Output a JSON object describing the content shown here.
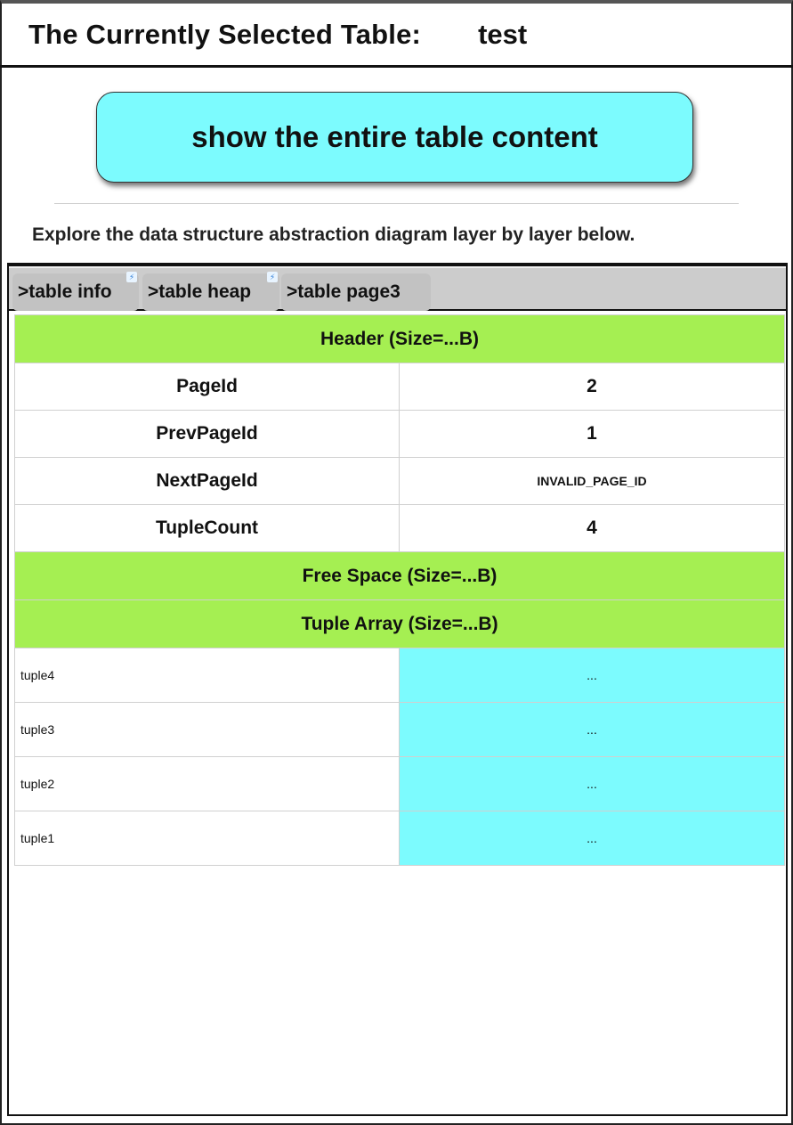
{
  "header": {
    "title_label": "The Currently Selected Table:",
    "table_name": "test"
  },
  "actions": {
    "show_button_label": "show the entire table content"
  },
  "instructions": "Explore the data structure abstraction diagram layer by layer below.",
  "breadcrumb": {
    "tabs": [
      {
        "label": ">table info",
        "badge": true
      },
      {
        "label": ">table heap",
        "badge": true
      },
      {
        "label": ">table page3",
        "badge": false
      }
    ]
  },
  "page": {
    "header_section": "Header (Size=...B)",
    "fields": [
      {
        "name": "PageId",
        "value": "2"
      },
      {
        "name": "PrevPageId",
        "value": "1"
      },
      {
        "name": "NextPageId",
        "value": "INVALID_PAGE_ID"
      },
      {
        "name": "TupleCount",
        "value": "4"
      }
    ],
    "free_space_section": "Free Space (Size=...B)",
    "tuple_array_section": "Tuple Array (Size=...B)",
    "tuples": [
      {
        "name": "tuple4",
        "value": "..."
      },
      {
        "name": "tuple3",
        "value": "..."
      },
      {
        "name": "tuple2",
        "value": "..."
      },
      {
        "name": "tuple1",
        "value": "..."
      }
    ]
  },
  "colors": {
    "accent_cyan": "#7cfbfe",
    "section_green": "#a5ef52",
    "tabbar_gray": "#cccccc"
  }
}
